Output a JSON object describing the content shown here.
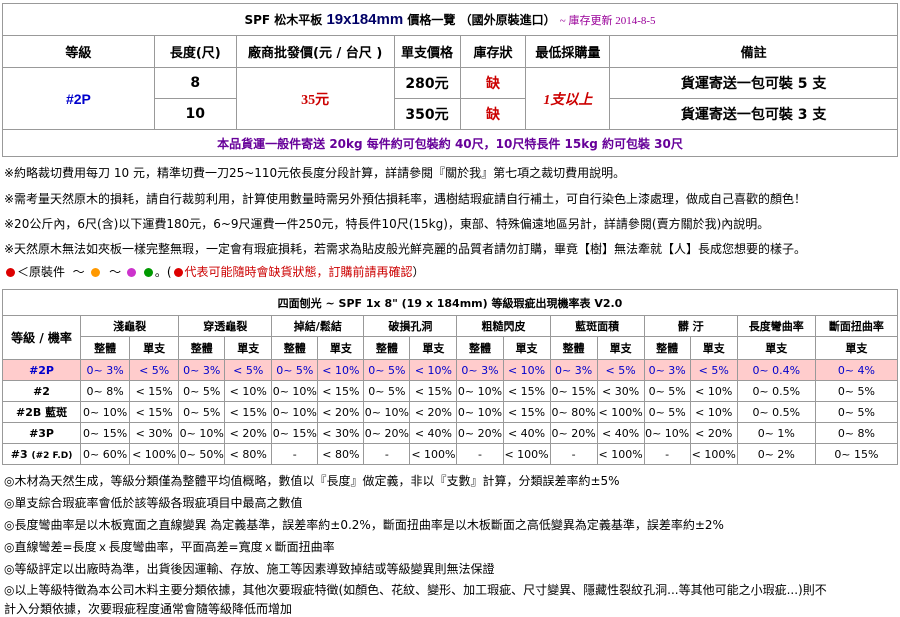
{
  "price_table": {
    "title_prefix": "SPF  松木平板",
    "title_size": "19x184mm",
    "title_suffix": "價格一覽    （國外原裝進口）",
    "update_note": "~ 庫存更新 2014-8-5",
    "headers": [
      "等級",
      "長度(尺)",
      "廠商批發價(元 / 台尺 )",
      "單支價格",
      "庫存狀",
      "最低採購量",
      "備註"
    ],
    "grade": "#2P",
    "wholesale": "35元",
    "min_qty": "1支以上",
    "rows": [
      {
        "length": "8",
        "unit_price": "280元",
        "stock": "缺",
        "remark": "貨運寄送一包可裝 5 支"
      },
      {
        "length": "10",
        "unit_price": "350元",
        "stock": "缺",
        "remark": "貨運寄送一包可裝 3 支"
      }
    ],
    "shipping": "本品貨運一般件寄送 20kg 每件約可包裝約 40尺，10尺特長件 15kg 約可包裝 30尺"
  },
  "notes": [
    "※約略裁切費用每刀 10 元，精準切費一刀25~110元依長度分段計算，詳請參閱『關於我』第七項之裁切費用說明。",
    "※需考量天然原木的損耗，請自行裁剪利用，計算使用數量時需另外預估損耗率，遇樹結瑕疵請自行補土，可自行染色上漆處理，做成自己喜歡的顏色！",
    "※20公斤內，6尺(含)以下運費180元，6~9尺運費一件250元，特長件10尺(15kg)，東部、特殊偏遠地區另計，詳請參閱(賣方關於我)內說明。",
    "※天然原木無法如夾板一樣完整無瑕，一定會有瑕疵損耗，若需求為貼皮般光鮮亮麗的品質者請勿訂購，畢竟【樹】無法牽就【人】長成您想要的樣子。"
  ],
  "legend": {
    "label": "＜原裝件",
    "tilde": "～",
    "red_text": "代表可能隨時會缺貨狀態，訂購前請再確認",
    "close": "）",
    "open": "。(",
    "colors": [
      "#dd0000",
      "#ff9900",
      "#cc33cc",
      "#009900"
    ]
  },
  "defect_table": {
    "title": "四面刨光 ~ SPF 1x 8\" (19 x 184mm) 等級瑕疵出現機率表 V2.0",
    "corner": "等級 / 機率",
    "categories": [
      "淺龜裂",
      "穿透龜裂",
      "掉結/鬆結",
      "破損孔洞",
      "粗糙閃皮",
      "藍斑面積",
      "髒 汙",
      "長度彎曲率",
      "斷面扭曲率"
    ],
    "sub_whole": "整體",
    "sub_single": "單支",
    "rows": [
      {
        "grade": "#2P",
        "cells": [
          "0~ 3%",
          "< 5%",
          "0~ 3%",
          "< 5%",
          "0~ 5%",
          "< 10%",
          "0~ 5%",
          "< 10%",
          "0~ 3%",
          "< 10%",
          "0~ 3%",
          "< 5%",
          "0~ 3%",
          "< 5%",
          "0~ 0.4%",
          "0~ 4%"
        ]
      },
      {
        "grade": "#2",
        "cells": [
          "0~ 8%",
          "< 15%",
          "0~ 5%",
          "< 10%",
          "0~ 10%",
          "< 15%",
          "0~ 5%",
          "< 15%",
          "0~ 10%",
          "< 15%",
          "0~ 15%",
          "< 30%",
          "0~ 5%",
          "< 10%",
          "0~ 0.5%",
          "0~ 5%"
        ]
      },
      {
        "grade": "#2B 藍斑",
        "cells": [
          "0~ 10%",
          "< 15%",
          "0~ 5%",
          "< 15%",
          "0~ 10%",
          "< 20%",
          "0~ 10%",
          "< 20%",
          "0~ 10%",
          "< 15%",
          "0~ 80%",
          "< 100%",
          "0~ 5%",
          "< 10%",
          "0~ 0.5%",
          "0~ 5%"
        ]
      },
      {
        "grade": "#3P",
        "cells": [
          "0~ 15%",
          "< 30%",
          "0~ 10%",
          "< 20%",
          "0~ 15%",
          "< 30%",
          "0~ 20%",
          "< 40%",
          "0~ 20%",
          "< 40%",
          "0~ 20%",
          "< 40%",
          "0~ 10%",
          "< 20%",
          "0~ 1%",
          "0~ 8%"
        ]
      },
      {
        "grade": "#3",
        "grade_small": "(#2 F.D)",
        "cells": [
          "0~ 60%",
          "< 100%",
          "0~ 50%",
          "< 80%",
          "-",
          "< 80%",
          "-",
          "< 100%",
          "-",
          "< 100%",
          "-",
          "< 100%",
          "-",
          "< 100%",
          "0~ 2%",
          "0~ 15%"
        ]
      }
    ]
  },
  "footnotes": [
    "◎木材為天然生成，等級分類僅為整體平均值概略，數值以『長度』做定義，非以『支數』計算，分類誤差率約±5%",
    "◎單支綜合瑕疵率會低於該等級各瑕疵項目中最高之數值",
    "◎長度彎曲率是以木板寬面之直線變異 為定義基準，誤差率約±0.2%，斷面扭曲率是以木板斷面之高低變異為定義基準，誤差率約±2%",
    "◎直線彎差=長度ｘ長度彎曲率，平面高差=寬度ｘ斷面扭曲率",
    "◎等級評定以出廠時為準，出貨後因運輸、存放、施工等因素導致掉結或等級變異則無法保證",
    "◎以上等級特徵為本公司木料主要分類依據，其他次要瑕疵特徵(如顏色、花紋、變形、加工瑕疵、尺寸變異、隱藏性裂紋孔洞...等其他可能之小瑕疵...)則不",
    "計入分類依據，次要瑕疵程度通常會隨等級降低而增加"
  ]
}
